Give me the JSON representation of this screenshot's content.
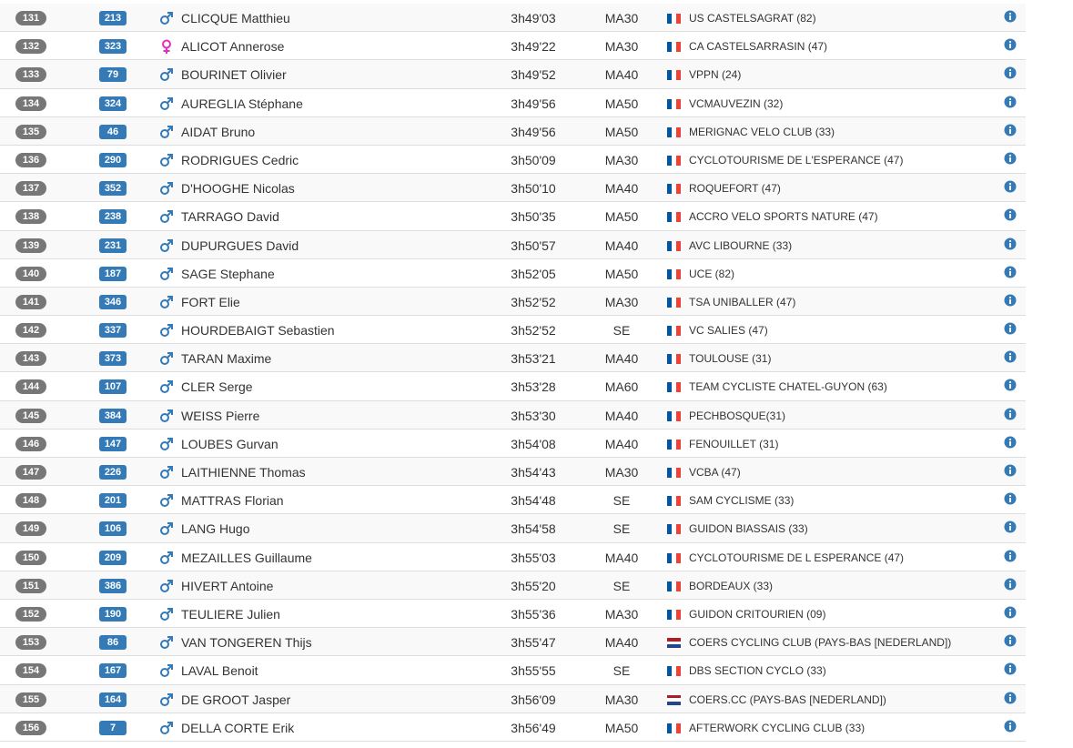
{
  "colors": {
    "position_badge": "#777777",
    "bib_badge": "#337ab7",
    "male_icon": "#337ab7",
    "female_icon": "#e62dc3",
    "info_icon": "#337ab7",
    "flag_fr": [
      "#0055a4",
      "#ffffff",
      "#ef4135"
    ],
    "flag_nl": [
      "#ae1c28",
      "#ffffff",
      "#21468b"
    ]
  },
  "rows": [
    {
      "pos": "131",
      "bib": "213",
      "sex": "male",
      "name": "CLICQUE Matthieu",
      "time": "3h49'03",
      "cat": "MA30",
      "flag": "fr",
      "club": "US CASTELSAGRAT (82)"
    },
    {
      "pos": "132",
      "bib": "323",
      "sex": "female",
      "name": "ALICOT Annerose",
      "time": "3h49'22",
      "cat": "MA30",
      "flag": "fr",
      "club": "CA CASTELSARRASIN (47)"
    },
    {
      "pos": "133",
      "bib": "79",
      "sex": "male",
      "name": "BOURINET Olivier",
      "time": "3h49'52",
      "cat": "MA40",
      "flag": "fr",
      "club": "VPPN (24)"
    },
    {
      "pos": "134",
      "bib": "324",
      "sex": "male",
      "name": "AUREGLIA Stéphane",
      "time": "3h49'56",
      "cat": "MA50",
      "flag": "fr",
      "club": "VCMAUVEZIN (32)"
    },
    {
      "pos": "135",
      "bib": "46",
      "sex": "male",
      "name": "AIDAT Bruno",
      "time": "3h49'56",
      "cat": "MA50",
      "flag": "fr",
      "club": "MERIGNAC VELO CLUB (33)"
    },
    {
      "pos": "136",
      "bib": "290",
      "sex": "male",
      "name": "RODRIGUES Cedric",
      "time": "3h50'09",
      "cat": "MA30",
      "flag": "fr",
      "club": "CYCLOTOURISME DE L'ESPERANCE (47)"
    },
    {
      "pos": "137",
      "bib": "352",
      "sex": "male",
      "name": "D'HOOGHE Nicolas",
      "time": "3h50'10",
      "cat": "MA40",
      "flag": "fr",
      "club": "ROQUEFORT (47)"
    },
    {
      "pos": "138",
      "bib": "238",
      "sex": "male",
      "name": "TARRAGO David",
      "time": "3h50'35",
      "cat": "MA50",
      "flag": "fr",
      "club": "ACCRO VELO SPORTS NATURE (47)"
    },
    {
      "pos": "139",
      "bib": "231",
      "sex": "male",
      "name": "DUPURGUES David",
      "time": "3h50'57",
      "cat": "MA40",
      "flag": "fr",
      "club": "AVC LIBOURNE (33)"
    },
    {
      "pos": "140",
      "bib": "187",
      "sex": "male",
      "name": "SAGE Stephane",
      "time": "3h52'05",
      "cat": "MA50",
      "flag": "fr",
      "club": "UCE (82)"
    },
    {
      "pos": "141",
      "bib": "346",
      "sex": "male",
      "name": "FORT Elie",
      "time": "3h52'52",
      "cat": "MA30",
      "flag": "fr",
      "club": "TSA UNIBALLER (47)"
    },
    {
      "pos": "142",
      "bib": "337",
      "sex": "male",
      "name": "HOURDEBAIGT Sebastien",
      "time": "3h52'52",
      "cat": "SE",
      "flag": "fr",
      "club": "VC SALIES (47)"
    },
    {
      "pos": "143",
      "bib": "373",
      "sex": "male",
      "name": "TARAN Maxime",
      "time": "3h53'21",
      "cat": "MA40",
      "flag": "fr",
      "club": "TOULOUSE (31)"
    },
    {
      "pos": "144",
      "bib": "107",
      "sex": "male",
      "name": "CLER Serge",
      "time": "3h53'28",
      "cat": "MA60",
      "flag": "fr",
      "club": "TEAM CYCLISTE CHATEL-GUYON (63)"
    },
    {
      "pos": "145",
      "bib": "384",
      "sex": "male",
      "name": "WEISS Pierre",
      "time": "3h53'30",
      "cat": "MA40",
      "flag": "fr",
      "club": "PECHBOSQUE(31)"
    },
    {
      "pos": "146",
      "bib": "147",
      "sex": "male",
      "name": "LOUBES Gurvan",
      "time": "3h54'08",
      "cat": "MA40",
      "flag": "fr",
      "club": "FENOUILLET (31)"
    },
    {
      "pos": "147",
      "bib": "226",
      "sex": "male",
      "name": "LAITHIENNE Thomas",
      "time": "3h54'43",
      "cat": "MA30",
      "flag": "fr",
      "club": "VCBA (47)"
    },
    {
      "pos": "148",
      "bib": "201",
      "sex": "male",
      "name": "MATTRAS Florian",
      "time": "3h54'48",
      "cat": "SE",
      "flag": "fr",
      "club": "SAM CYCLISME (33)"
    },
    {
      "pos": "149",
      "bib": "106",
      "sex": "male",
      "name": "LANG Hugo",
      "time": "3h54'58",
      "cat": "SE",
      "flag": "fr",
      "club": "GUIDON BIASSAIS (33)"
    },
    {
      "pos": "150",
      "bib": "209",
      "sex": "male",
      "name": "MEZAILLES Guillaume",
      "time": "3h55'03",
      "cat": "MA40",
      "flag": "fr",
      "club": "CYCLOTOURISME DE L ESPERANCE (47)"
    },
    {
      "pos": "151",
      "bib": "386",
      "sex": "male",
      "name": "HIVERT Antoine",
      "time": "3h55'20",
      "cat": "SE",
      "flag": "fr",
      "club": "BORDEAUX (33)"
    },
    {
      "pos": "152",
      "bib": "190",
      "sex": "male",
      "name": "TEULIERE Julien",
      "time": "3h55'36",
      "cat": "MA30",
      "flag": "fr",
      "club": "GUIDON CRITOURIEN (09)"
    },
    {
      "pos": "153",
      "bib": "86",
      "sex": "male",
      "name": "VAN TONGEREN Thijs",
      "time": "3h55'47",
      "cat": "MA40",
      "flag": "nl",
      "club": "COERS CYCLING CLUB (PAYS-BAS [NEDERLAND])"
    },
    {
      "pos": "154",
      "bib": "167",
      "sex": "male",
      "name": "LAVAL Benoit",
      "time": "3h55'55",
      "cat": "SE",
      "flag": "fr",
      "club": "DBS SECTION CYCLO (33)"
    },
    {
      "pos": "155",
      "bib": "164",
      "sex": "male",
      "name": "DE GROOT Jasper",
      "time": "3h56'09",
      "cat": "MA30",
      "flag": "nl",
      "club": "COERS.CC (PAYS-BAS [NEDERLAND])"
    },
    {
      "pos": "156",
      "bib": "7",
      "sex": "male",
      "name": "DELLA CORTE Erik",
      "time": "3h56'49",
      "cat": "MA50",
      "flag": "fr",
      "club": "AFTERWORK CYCLING CLUB (33)"
    }
  ]
}
